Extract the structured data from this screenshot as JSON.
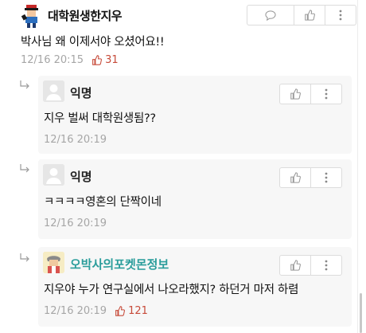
{
  "top_comment": {
    "author": "대학원생한지우",
    "text": "박사님 왜 이제서야 오셨어요!!",
    "time": "12/16 20:15",
    "likes": "31"
  },
  "replies": [
    {
      "author": "익명",
      "text": "지우 벌써 대학원생됨??",
      "time": "12/16 20:19",
      "likes": ""
    },
    {
      "author": "익명",
      "text": "ㅋㅋㅋㅋ영혼의 단짝이네",
      "time": "12/16 20:19",
      "likes": ""
    },
    {
      "author": "오박사의포켓몬정보",
      "text": "지우야 누가 연구실에서 나오라했지? 하던거 마저 하렴",
      "time": "12/16 20:19",
      "likes": "121"
    }
  ],
  "colors": {
    "accent_teal": "#2a9d9b",
    "like_red": "#c74b3a",
    "meta_gray": "#a6a6a6"
  },
  "icons": [
    "reply-icon",
    "thumbs-up-icon",
    "more-icon",
    "reply-arrow-icon",
    "anonymous-avatar-icon"
  ]
}
